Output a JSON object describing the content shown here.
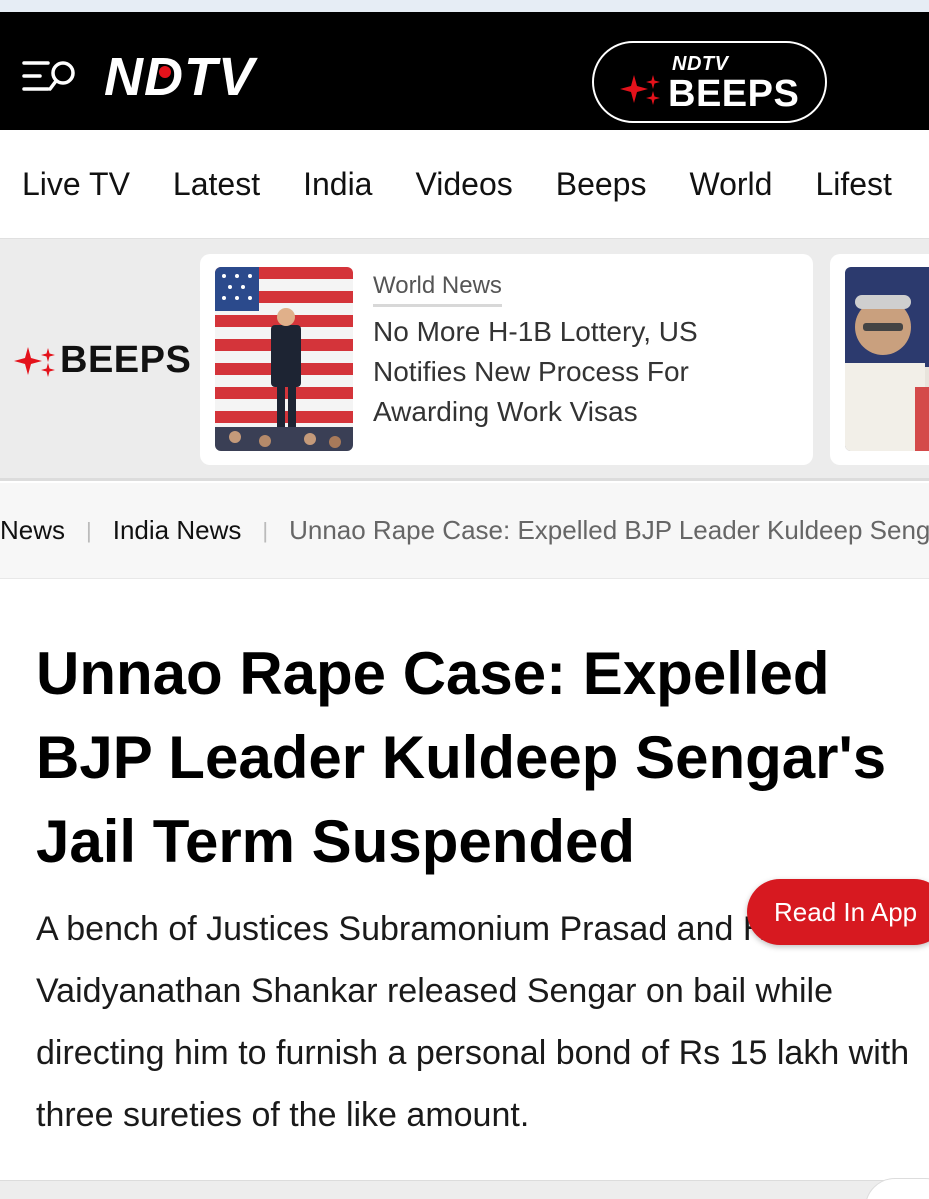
{
  "header": {
    "logo_text": "NDTV",
    "menu_icon": "menu-search-icon",
    "beeps_button": {
      "small_label": "NDTV",
      "label": "BEEPS",
      "icon": "sparkle-icon"
    },
    "colors": {
      "background": "#000000",
      "accent": "#e4121b"
    }
  },
  "nav": {
    "items": [
      "Live TV",
      "Latest",
      "India",
      "Videos",
      "Beeps",
      "World",
      "Lifest"
    ]
  },
  "beeps_band": {
    "label": "BEEPS",
    "cards": [
      {
        "category": "World News",
        "title": "No More H-1B Lottery, US Notifies New Process For Awarding Work Visas"
      }
    ]
  },
  "breadcrumb": {
    "items": [
      "News",
      "India News"
    ],
    "current": "Unnao Rape Case: Expelled BJP Leader Kuldeep Sengar's Jail Term Suspended"
  },
  "article": {
    "headline": "Unnao Rape Case: Expelled BJP Leader Kuldeep Sengar's Jail Term Suspended",
    "summary": "A bench of Justices Subramonium Prasad and Harish Vaidyanathan Shankar released Sengar on bail while directing him to furnish a personal bond of Rs 15 lakh with three sureties of the like amount."
  },
  "read_in_app": {
    "label": "Read In App",
    "color": "#d71920"
  }
}
